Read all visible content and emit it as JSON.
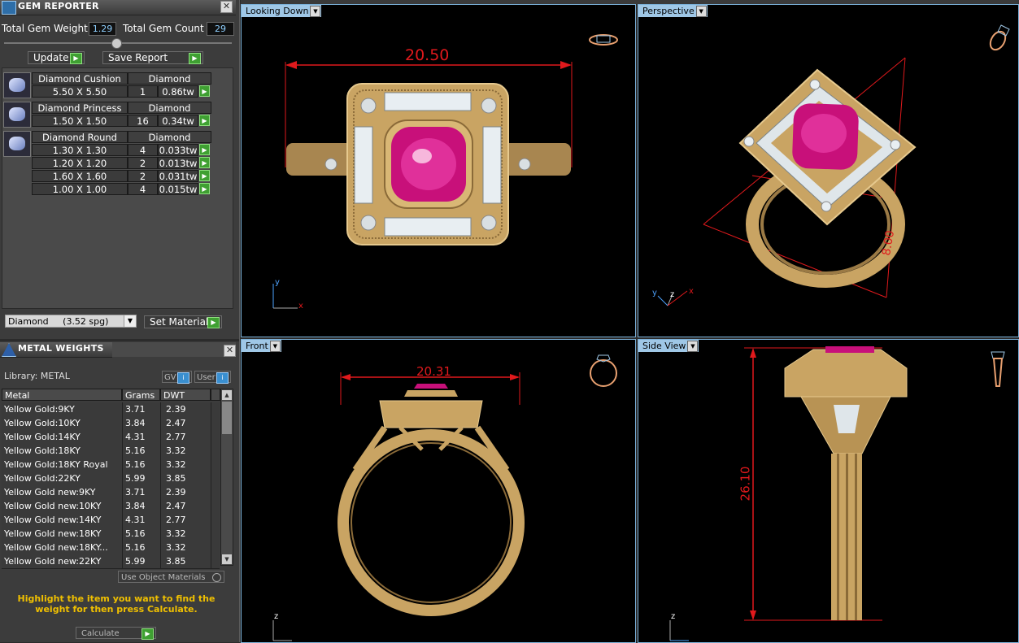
{
  "gem_reporter": {
    "title": "GEM REPORTER",
    "total_weight_label": "Total Gem Weight",
    "total_weight_value": "1.29",
    "total_count_label": "Total Gem Count",
    "total_count_value": "29",
    "update_label": "Update",
    "save_report_label": "Save Report",
    "groups": [
      {
        "name": "Diamond Cushion",
        "material": "Diamond",
        "rows": [
          {
            "size": "5.50 X 5.50",
            "count": "1",
            "weight": "0.86tw"
          }
        ]
      },
      {
        "name": "Diamond Princess",
        "material": "Diamond",
        "rows": [
          {
            "size": "1.50 X 1.50",
            "count": "16",
            "weight": "0.34tw"
          }
        ]
      },
      {
        "name": "Diamond Round",
        "material": "Diamond",
        "rows": [
          {
            "size": "1.30 X 1.30",
            "count": "4",
            "weight": "0.033tw"
          },
          {
            "size": "1.20 X 1.20",
            "count": "2",
            "weight": "0.013tw"
          },
          {
            "size": "1.60 X 1.60",
            "count": "2",
            "weight": "0.031tw"
          },
          {
            "size": "1.00 X 1.00",
            "count": "4",
            "weight": "0.015tw"
          }
        ]
      }
    ],
    "material_select": "Diamond     (3.52 spg)",
    "set_material_label": "Set Material"
  },
  "metal_weights": {
    "title": "METAL WEIGHTS",
    "library_label": "Library: METAL",
    "gv_label": "GV",
    "user_label": "User",
    "columns": [
      "Metal",
      "Grams",
      "DWT"
    ],
    "rows": [
      [
        "Yellow Gold:9KY",
        "3.71",
        "2.39"
      ],
      [
        "Yellow Gold:10KY",
        "3.84",
        "2.47"
      ],
      [
        "Yellow Gold:14KY",
        "4.31",
        "2.77"
      ],
      [
        "Yellow Gold:18KY",
        "5.16",
        "3.32"
      ],
      [
        "Yellow Gold:18KY Royal",
        "5.16",
        "3.32"
      ],
      [
        "Yellow Gold:22KY",
        "5.99",
        "3.85"
      ],
      [
        "Yellow Gold new:9KY",
        "3.71",
        "2.39"
      ],
      [
        "Yellow Gold new:10KY",
        "3.84",
        "2.47"
      ],
      [
        "Yellow Gold new:14KY",
        "4.31",
        "2.77"
      ],
      [
        "Yellow Gold new:18KY",
        "5.16",
        "3.32"
      ],
      [
        "Yellow Gold new:18KY...",
        "5.16",
        "3.32"
      ],
      [
        "Yellow Gold new:22KY",
        "5.99",
        "3.85"
      ]
    ],
    "use_object_materials": "Use Object Materials",
    "hint": "Highlight the item you want to find the weight for then press Calculate.",
    "calculate_label": "Calculate"
  },
  "viewports": {
    "top_left": {
      "label": "Looking Down",
      "dimension": "20.50",
      "axis_y": "y",
      "axis_x": "x"
    },
    "top_right": {
      "label": "Perspective",
      "dimension": "8.00",
      "axis_y": "y",
      "axis_z": "z",
      "axis_x": "x"
    },
    "bottom_left": {
      "label": "Front",
      "dimension": "20.31",
      "axis_z": "z"
    },
    "bottom_right": {
      "label": "Side View",
      "dimension": "26.10",
      "axis_z": "z"
    }
  },
  "colors": {
    "accent_green": "#3fa032",
    "viewport_tab": "#9fc7e6",
    "dimension_red": "#e0191c",
    "gold": "#c9a463",
    "ruby": "#d0107a",
    "hint_yellow": "#f0c000"
  }
}
